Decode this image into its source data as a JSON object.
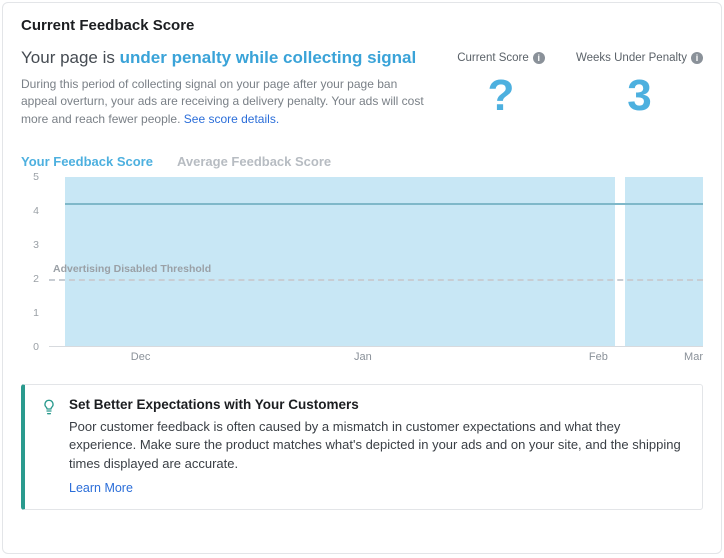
{
  "card": {
    "title": "Current Feedback Score"
  },
  "status": {
    "prefix": "Your page is ",
    "highlight": "under penalty while collecting signal",
    "description": "During this period of collecting signal on your page after your page ban appeal overturn, your ads are receiving a delivery penalty. Your ads will cost more and reach fewer people. ",
    "link": "See score details."
  },
  "metrics": {
    "current": {
      "label": "Current Score",
      "value": "?"
    },
    "weeks": {
      "label": "Weeks Under Penalty",
      "value": "3"
    }
  },
  "tabs": {
    "active": "Your Feedback Score",
    "inactive": "Average Feedback Score"
  },
  "chart_data": {
    "type": "line",
    "ylim": [
      0,
      5
    ],
    "y_ticks": [
      0,
      1,
      2,
      3,
      4,
      5
    ],
    "x_categories": [
      "Dec",
      "Jan",
      "Feb",
      "Mar"
    ],
    "x_positions_pct": [
      14,
      48,
      84,
      100
    ],
    "threshold": {
      "value": 2,
      "label": "Advertising Disabled Threshold"
    },
    "series": [
      {
        "name": "Your Feedback Score",
        "flat_value": 4.25
      }
    ],
    "shaded_region": {
      "start_pct": 2.5,
      "end_pct": 100,
      "gap_start_pct": 86.5,
      "gap_end_pct": 88
    }
  },
  "tip": {
    "title": "Set Better Expectations with Your Customers",
    "body": "Poor customer feedback is often caused by a mismatch in customer expectations and what they experience. Make sure the product matches what's depicted in your ads and on your site, and the shipping times displayed are accurate.",
    "link": "Learn More"
  }
}
